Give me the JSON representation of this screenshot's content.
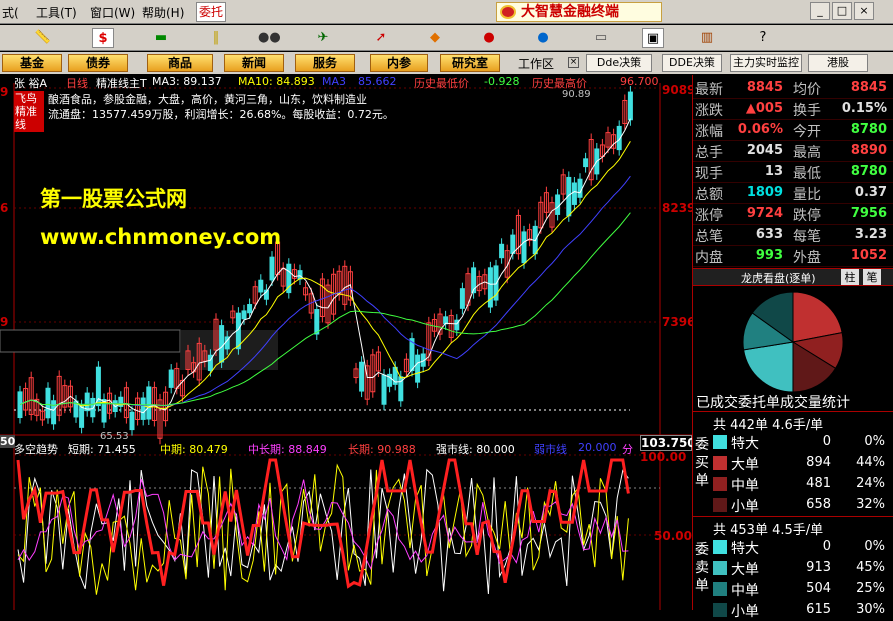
{
  "menubar": {
    "items": [
      "式(",
      "工具(T)",
      "窗口(W)",
      "帮助(H)"
    ],
    "active": "委托",
    "brand": "大智慧金融终端",
    "window_buttons": [
      "_",
      "□",
      "×"
    ]
  },
  "toolbar": {
    "icons": [
      "ruler-icon",
      "dollar-icon",
      "flag-icon",
      "bars-icon",
      "binocular-icon",
      "satellite-icon",
      "arrow-icon",
      "diamond-icon",
      "circle-icon",
      "dollar2-icon",
      "screen-icon",
      "window-icon",
      "books-icon",
      "help-icon"
    ]
  },
  "funcbar": {
    "buttons": [
      "基金",
      "债券",
      "商品",
      "新闻",
      "服务",
      "内参",
      "研究室"
    ],
    "workspace": "工作区",
    "extras": [
      "Dde决策",
      "DDE决策",
      "主力实时监控",
      "港股"
    ]
  },
  "chart": {
    "stock_name": "张 裕A",
    "period": "日线",
    "indicator": "精准线主T",
    "ma3": "MA3: 89.137",
    "ma10": "MA10: 84.893",
    "ma": "MA3",
    "ma_val": "85.662",
    "hist_low_label": "历史最低价",
    "hist_low": "-0.928",
    "hist_high_label": "历史最高价",
    "hist_high": "96.700",
    "tag": "飞鸟精准线",
    "info1": "酿酒食品，参股金融，大盘，高价，黄河三角，山东，饮料制造业",
    "info2": "流通盘：13577.459万股，利润增长：26.68%。每股收益：0.72元。",
    "watermark1": "第一股票公式网",
    "watermark2": "www.chnmoney.com",
    "low_price": "65.53",
    "peak_price": "90.89",
    "price_axis": [
      "9089",
      "8239",
      "7396"
    ],
    "price_right": "103.750",
    "sub_name": "多空趋势",
    "sub_short": "短期: 71.455",
    "sub_mid": "中期: 80.479",
    "sub_midlong": "中长期: 88.849",
    "sub_long": "长期: 90.988",
    "sub_strong": "强市线: 80.000",
    "sub_weak": "弱市线",
    "sub_weak_val": "20.000",
    "sub_fen": "分",
    "sub_axis": [
      "100.00",
      "50.00"
    ],
    "left_axis": [
      "50",
      "9",
      "6",
      "9"
    ]
  },
  "rpanel": {
    "rows": [
      {
        "l1": "最新",
        "v1": "8845",
        "c1": "#ff4040",
        "l2": "均价",
        "v2": "8845",
        "c2": "#ff4040"
      },
      {
        "l1": "涨跌",
        "v1": "▲005",
        "c1": "#ff4040",
        "l2": "换手",
        "v2": "0.15%",
        "c2": "#e0e0e0"
      },
      {
        "l1": "涨幅",
        "v1": "0.06%",
        "c1": "#ff4040",
        "l2": "今开",
        "v2": "8780",
        "c2": "#40ff40"
      },
      {
        "l1": "总手",
        "v1": "2045",
        "c1": "#e0e0e0",
        "l2": "最高",
        "v2": "8890",
        "c2": "#ff4040"
      },
      {
        "l1": "现手",
        "v1": "13",
        "c1": "#e0e0e0",
        "l2": "最低",
        "v2": "8780",
        "c2": "#40ff40"
      },
      {
        "l1": "总额",
        "v1": "1809",
        "c1": "#00e0e0",
        "l2": "量比",
        "v2": "0.37",
        "c2": "#e0e0e0"
      },
      {
        "l1": "涨停",
        "v1": "9724",
        "c1": "#ff4040",
        "l2": "跌停",
        "v2": "7956",
        "c2": "#40ff40"
      },
      {
        "l1": "总笔",
        "v1": "633",
        "c1": "#e0e0e0",
        "l2": "每笔",
        "v2": "3.23",
        "c2": "#e0e0e0"
      },
      {
        "l1": "内盘",
        "v1": "993",
        "c1": "#40ff40",
        "l2": "外盘",
        "v2": "1052",
        "c2": "#ff4040"
      }
    ],
    "tabs": [
      "龙虎看盘(逐单)",
      "柱",
      "笔"
    ],
    "pie_title": "已成交委托单成交量统计",
    "buy_header": "共 442单 4.6手/单",
    "sell_header": "共 453单 4.5手/单",
    "buy_label": "委买单",
    "sell_label": "委卖单",
    "buy_rows": [
      {
        "n": "特大",
        "v": "0",
        "p": "0%",
        "c": "#40e0e0"
      },
      {
        "n": "大单",
        "v": "894",
        "p": "44%",
        "c": "#c03030"
      },
      {
        "n": "中单",
        "v": "481",
        "p": "24%",
        "c": "#902020"
      },
      {
        "n": "小单",
        "v": "658",
        "p": "32%",
        "c": "#601818"
      }
    ],
    "sell_rows": [
      {
        "n": "特大",
        "v": "0",
        "p": "0%",
        "c": "#40e0e0"
      },
      {
        "n": "大单",
        "v": "913",
        "p": "45%",
        "c": "#40c0c0"
      },
      {
        "n": "中单",
        "v": "504",
        "p": "25%",
        "c": "#208080"
      },
      {
        "n": "小单",
        "v": "615",
        "p": "30%",
        "c": "#104848"
      }
    ]
  }
}
